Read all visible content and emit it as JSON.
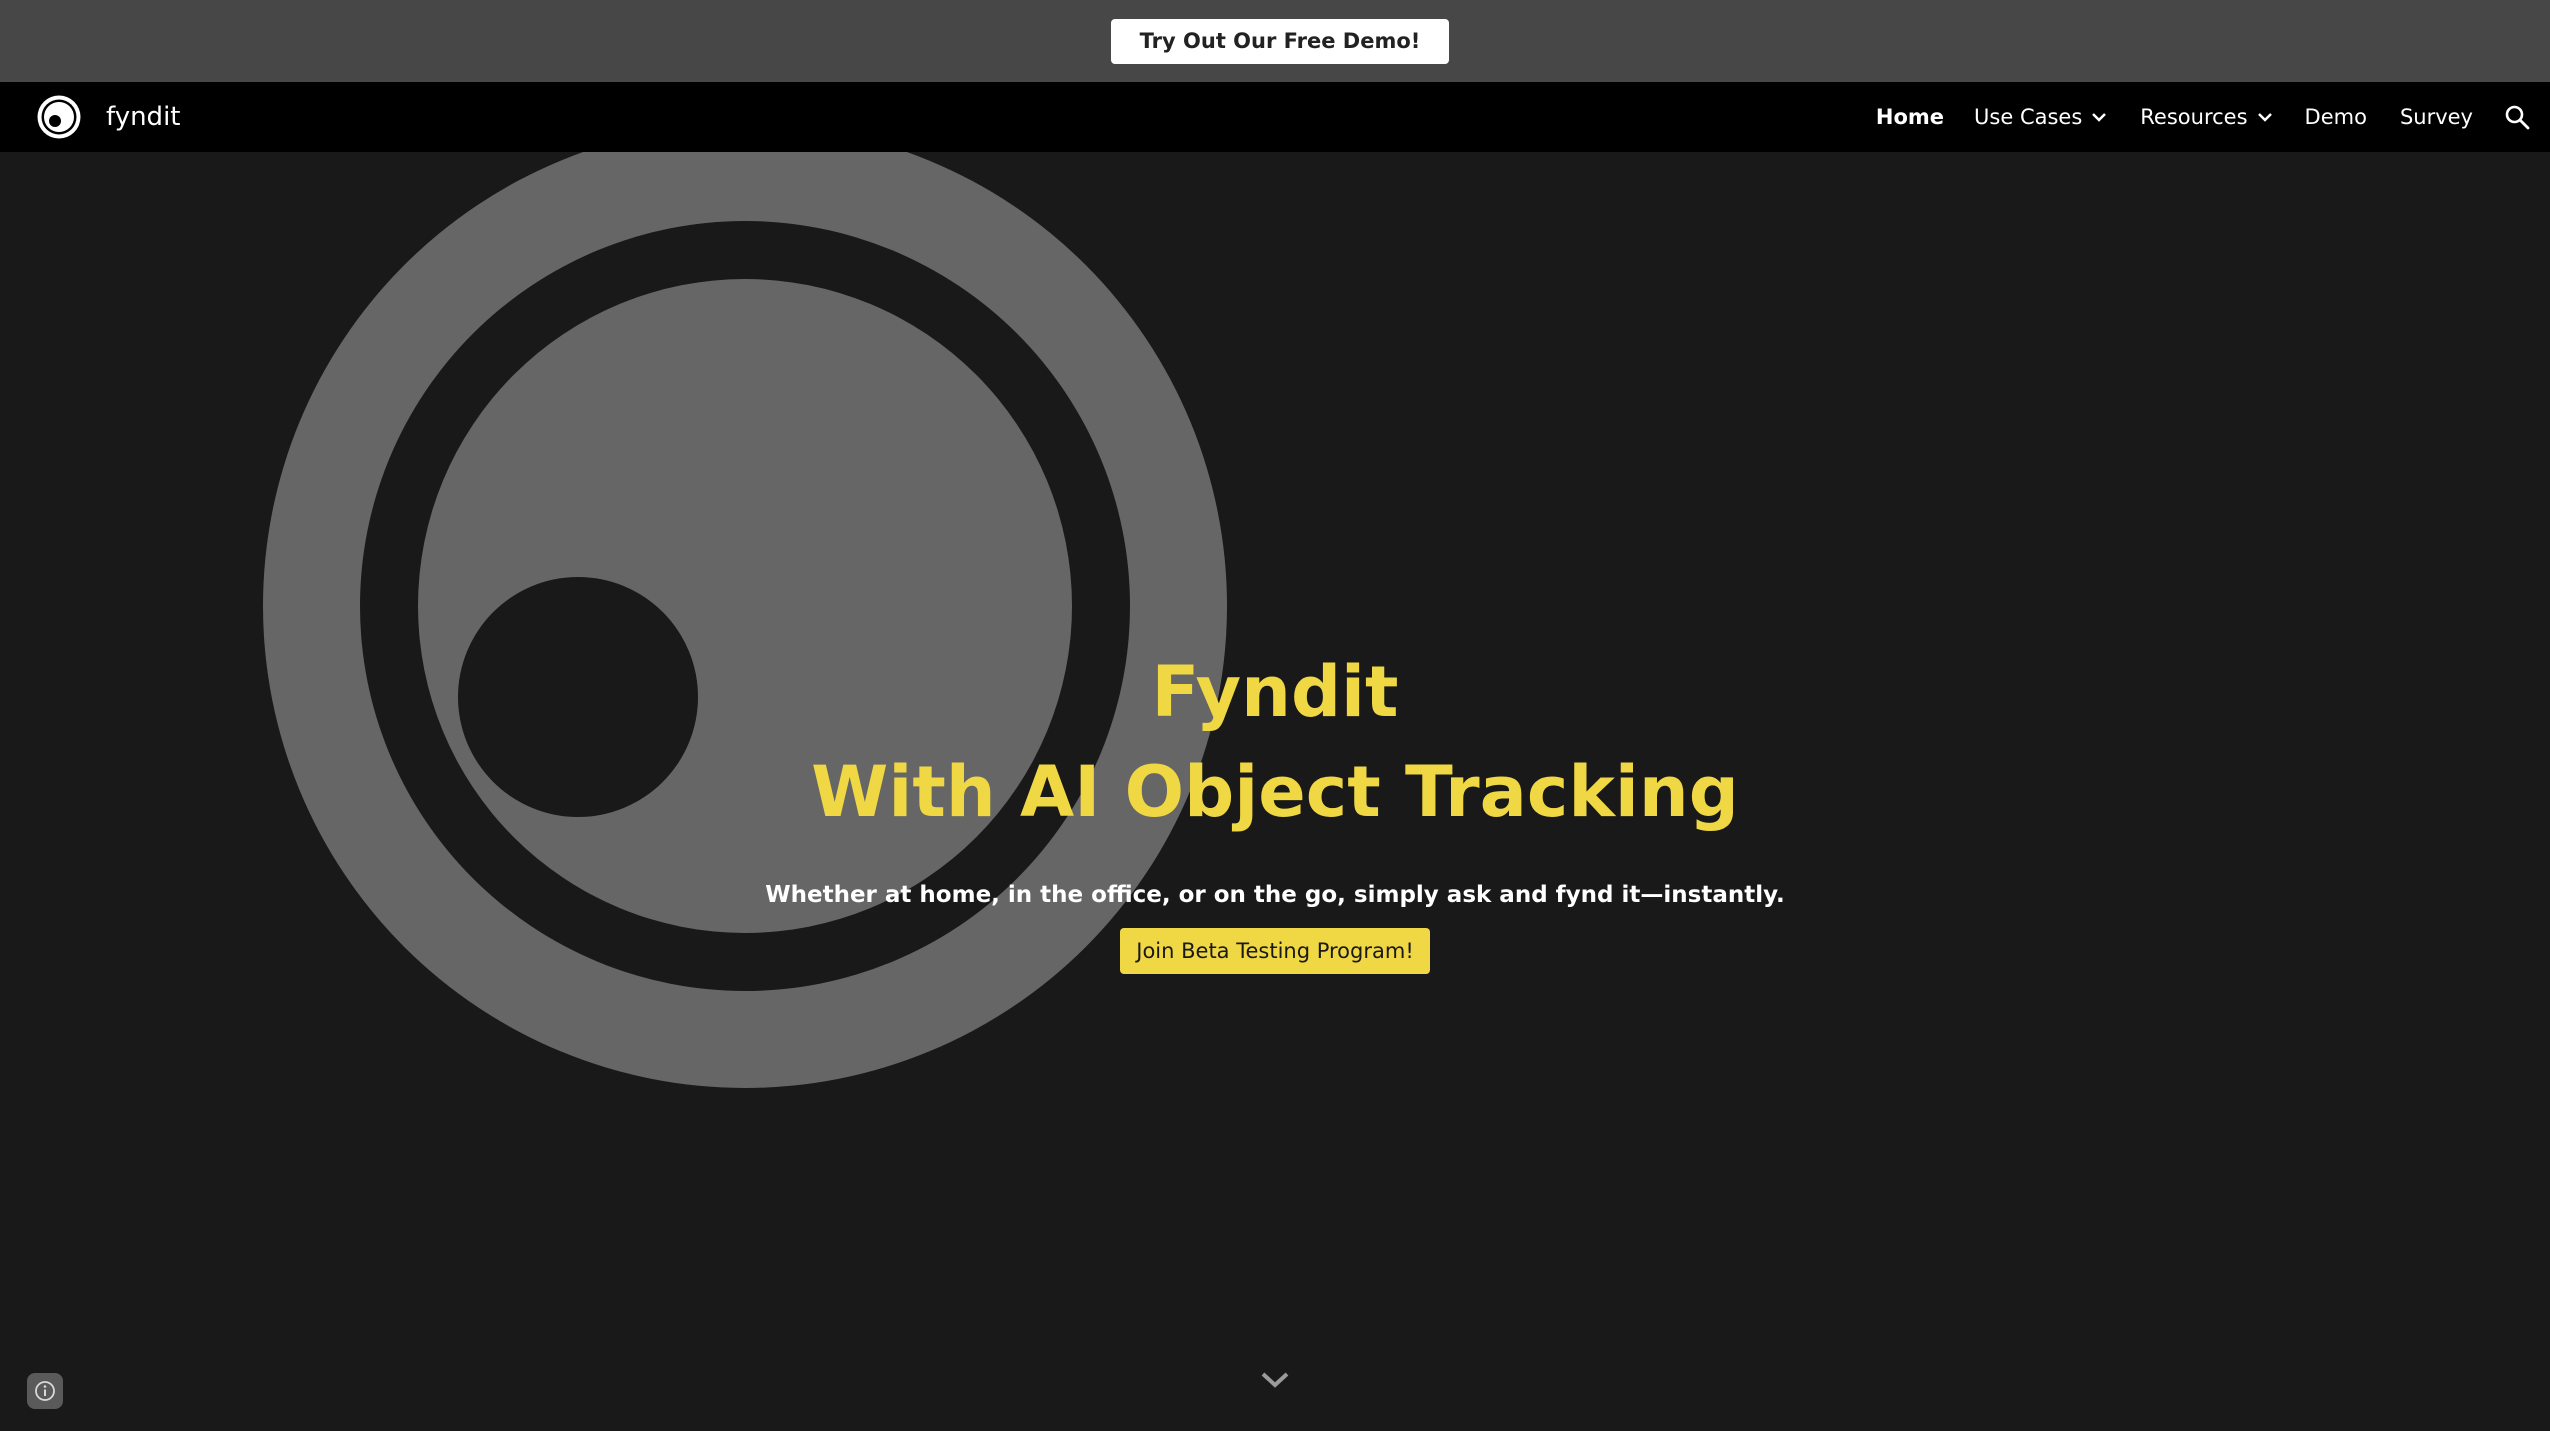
{
  "announcement": {
    "button_label": "Try Out Our Free Demo!"
  },
  "header": {
    "brand_name": "fyndit",
    "nav": [
      {
        "label": "Home",
        "active": true
      },
      {
        "label": "Use Cases",
        "has_dropdown": true
      },
      {
        "label": "Resources",
        "has_dropdown": true
      },
      {
        "label": "Demo"
      },
      {
        "label": "Survey"
      }
    ],
    "search_icon": "search-icon"
  },
  "hero": {
    "title_line1": "Fyndit",
    "title_line2": "With AI Object Tracking",
    "subtitle": "Whether at home, in the office, or on the go, simply ask and fynd it—instantly.",
    "cta_label": "Join Beta Testing Program!",
    "scroll_icon": "chevron-down-icon"
  },
  "footer": {
    "info_icon": "info-icon"
  },
  "colors": {
    "accent": "#f0d744",
    "background": "#191919",
    "announcement_bar": "#474747",
    "navbar": "#000000",
    "hero_logo_gray": "#666666"
  }
}
